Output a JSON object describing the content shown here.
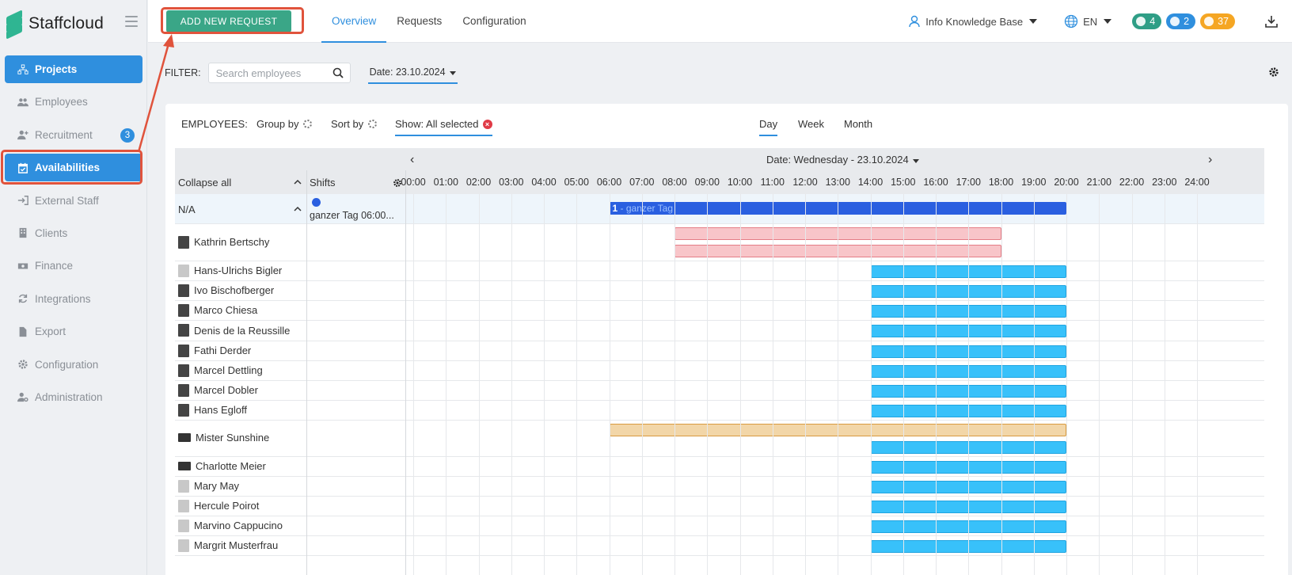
{
  "app": {
    "name": "Staffcloud"
  },
  "sidebar": {
    "items": [
      {
        "label": "Projects",
        "icon": "sitemap-icon",
        "active": false,
        "highlight": true
      },
      {
        "label": "Employees",
        "icon": "users-icon"
      },
      {
        "label": "Recruitment",
        "icon": "user-plus-icon",
        "badge": "3"
      },
      {
        "label": "Availabilities",
        "icon": "calendar-check-icon",
        "active": true
      },
      {
        "label": "External Staff",
        "icon": "sign-in-icon"
      },
      {
        "label": "Clients",
        "icon": "building-icon"
      },
      {
        "label": "Finance",
        "icon": "money-icon"
      },
      {
        "label": "Integrations",
        "icon": "sync-icon"
      },
      {
        "label": "Export",
        "icon": "file-icon"
      },
      {
        "label": "Configuration",
        "icon": "gear-icon"
      },
      {
        "label": "Administration",
        "icon": "user-cog-icon"
      }
    ]
  },
  "topbar": {
    "add_button": "ADD NEW REQUEST",
    "tabs": [
      {
        "label": "Overview",
        "active": true
      },
      {
        "label": "Requests"
      },
      {
        "label": "Configuration"
      }
    ],
    "user": "Info Knowledge Base",
    "language": "EN",
    "messages_count": "4",
    "notifications_count": "2",
    "pending_count": "37"
  },
  "filter": {
    "label": "FILTER:",
    "search_placeholder": "Search employees",
    "date": "Date: 23.10.2024"
  },
  "toolbar": {
    "employees_label": "EMPLOYEES:",
    "group_by": "Group by",
    "sort_by": "Sort by",
    "show": "Show: All selected",
    "views": [
      "Day",
      "Week",
      "Month"
    ],
    "active_view": "Day"
  },
  "grid": {
    "collapse_all": "Collapse all",
    "shifts_label": "Shifts",
    "date_title": "Date: Wednesday - 23.10.2024",
    "hours": [
      "00:00",
      "01:00",
      "02:00",
      "03:00",
      "04:00",
      "05:00",
      "06:00",
      "07:00",
      "08:00",
      "09:00",
      "10:00",
      "11:00",
      "12:00",
      "13:00",
      "14:00",
      "15:00",
      "16:00",
      "17:00",
      "18:00",
      "19:00",
      "20:00",
      "21:00",
      "22:00",
      "23:00",
      "24:00"
    ],
    "na_group": {
      "label": "N/A",
      "shift_text": "ganzer Tag 06:00...",
      "bar_count": "1",
      "bar_label": " - ganzer Tag",
      "start": 6,
      "end": 20
    },
    "employees": [
      {
        "name": "Kathrin Bertschy",
        "bars": [
          {
            "type": "red",
            "start": 8,
            "end": 18
          },
          {
            "type": "red",
            "start": 8,
            "end": 18
          }
        ]
      },
      {
        "name": "Hans-Ulrichs Bigler",
        "bars": [
          {
            "type": "blue",
            "start": 14,
            "end": 20
          }
        ]
      },
      {
        "name": "Ivo Bischofberger",
        "bars": [
          {
            "type": "blue",
            "start": 14,
            "end": 20
          }
        ]
      },
      {
        "name": "Marco Chiesa",
        "bars": [
          {
            "type": "blue",
            "start": 14,
            "end": 20
          }
        ]
      },
      {
        "name": "Denis de la Reussille",
        "bars": [
          {
            "type": "blue",
            "start": 14,
            "end": 20
          }
        ]
      },
      {
        "name": "Fathi Derder",
        "bars": [
          {
            "type": "blue",
            "start": 14,
            "end": 20
          }
        ]
      },
      {
        "name": "Marcel Dettling",
        "bars": [
          {
            "type": "blue",
            "start": 14,
            "end": 20
          }
        ]
      },
      {
        "name": "Marcel Dobler",
        "bars": [
          {
            "type": "blue",
            "start": 14,
            "end": 20
          }
        ]
      },
      {
        "name": "Hans Egloff",
        "bars": [
          {
            "type": "blue",
            "start": 14,
            "end": 20
          }
        ]
      },
      {
        "name": "Mister Sunshine",
        "bars": [
          {
            "type": "tan",
            "start": 6,
            "end": 20
          },
          {
            "type": "blue",
            "start": 14,
            "end": 20
          }
        ]
      },
      {
        "name": "Charlotte Meier",
        "bars": [
          {
            "type": "blue",
            "start": 14,
            "end": 20
          }
        ]
      },
      {
        "name": "Mary May",
        "bars": [
          {
            "type": "blue",
            "start": 14,
            "end": 20
          }
        ]
      },
      {
        "name": "Hercule Poirot",
        "bars": [
          {
            "type": "blue",
            "start": 14,
            "end": 20
          }
        ]
      },
      {
        "name": "Marvino Cappucino",
        "bars": [
          {
            "type": "blue",
            "start": 14,
            "end": 20
          }
        ]
      },
      {
        "name": "Margrit Musterfrau",
        "bars": [
          {
            "type": "blue",
            "start": 14,
            "end": 20
          }
        ]
      }
    ]
  },
  "colors": {
    "accent": "#2f8fde",
    "primary_button": "#3aa687",
    "annotation": "#e0533c"
  }
}
